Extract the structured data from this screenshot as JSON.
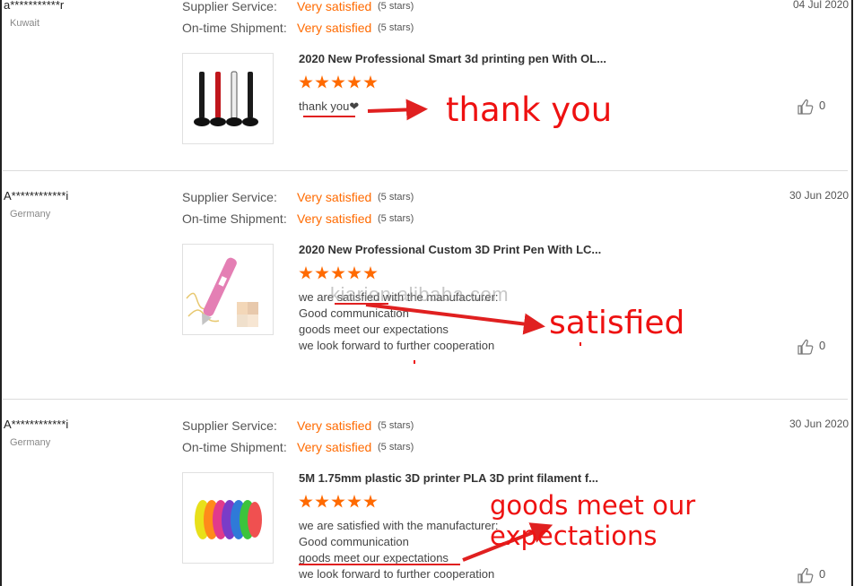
{
  "rating_labels": {
    "supplier": "Supplier Service:",
    "shipment": "On-time Shipment:"
  },
  "reviews": [
    {
      "buyer": "a***********r",
      "country": "Kuwait",
      "date": "04 Jul 2020",
      "supplier_rating": "Very satisfied",
      "supplier_stars": "(5 stars)",
      "shipment_rating": "Very satisfied",
      "shipment_stars": "(5 stars)",
      "product": "2020 New Professional Smart 3d printing pen With OL...",
      "stars": 5,
      "feedback": [
        "thank you❤"
      ],
      "likes": "0"
    },
    {
      "buyer": "A************i",
      "country": "Germany",
      "date": "30 Jun 2020",
      "supplier_rating": "Very satisfied",
      "supplier_stars": "(5 stars)",
      "shipment_rating": "Very satisfied",
      "shipment_stars": "(5 stars)",
      "product": "2020 New Professional Custom 3D Print Pen With LC...",
      "stars": 5,
      "feedback": [
        "we are satisfied with the manufacturer:",
        "Good communication",
        "goods meet our expectations",
        "we look forward to further cooperation"
      ],
      "likes": "0"
    },
    {
      "buyer": "A************i",
      "country": "Germany",
      "date": "30 Jun 2020",
      "supplier_rating": "Very satisfied",
      "supplier_stars": "(5 stars)",
      "shipment_rating": "Very satisfied",
      "shipment_stars": "(5 stars)",
      "product": "5M 1.75mm plastic 3D printer PLA 3D print filament f...",
      "stars": 5,
      "feedback": [
        "we are satisfied with the manufacturer:",
        "Good communication",
        "goods meet our expectations",
        "we look forward to further cooperation"
      ],
      "likes": "0"
    }
  ],
  "annotations": {
    "note1": "thank you",
    "note2": "satisfied",
    "note3": "goods meet our expectations",
    "color": "#ee1111"
  },
  "watermark": "kiarien.alibaba.com",
  "icons": {
    "like": "thumbs-up-icon",
    "star": "star-icon"
  },
  "colors": {
    "accent": "#ff6a00",
    "annotation": "#ee1111"
  }
}
